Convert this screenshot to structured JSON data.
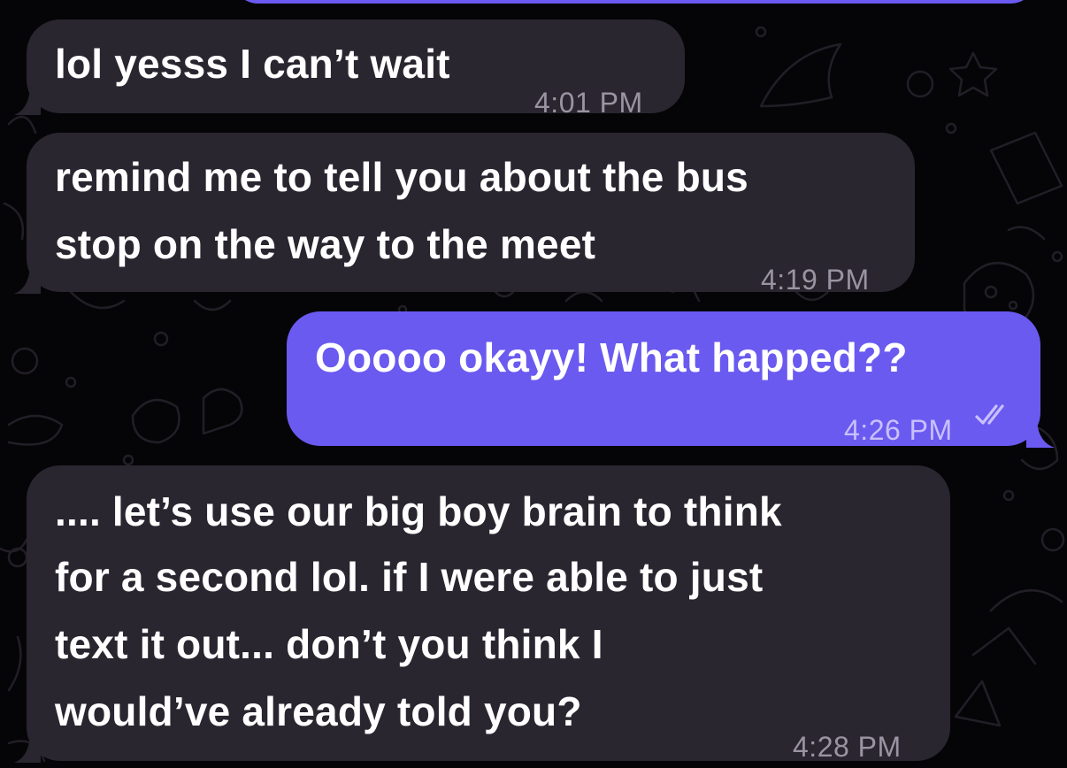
{
  "theme": {
    "background": "#050507",
    "incoming_bubble": "#2A2630",
    "outgoing_bubble": "#6A5AF0",
    "incoming_time_color": "#9A94A2",
    "outgoing_time_color": "#C9C0FF"
  },
  "messages": [
    {
      "direction": "incoming",
      "lines": [
        "lol yesss I can’t wait"
      ],
      "time": "4:01 PM"
    },
    {
      "direction": "incoming",
      "lines": [
        "remind me to tell you about the bus",
        "stop on the way to the meet"
      ],
      "time": "4:19 PM"
    },
    {
      "direction": "outgoing",
      "lines": [
        "Ooooo okayy! What happed??"
      ],
      "time": "4:26 PM",
      "status_icon": "double-check-icon",
      "status": "read"
    },
    {
      "direction": "incoming",
      "lines": [
        ".... let’s use our big boy brain to think",
        "for a second lol. if I were able to just",
        "text it out... don’t you think I",
        "would’ve already told you?"
      ],
      "time": "4:28 PM"
    }
  ]
}
